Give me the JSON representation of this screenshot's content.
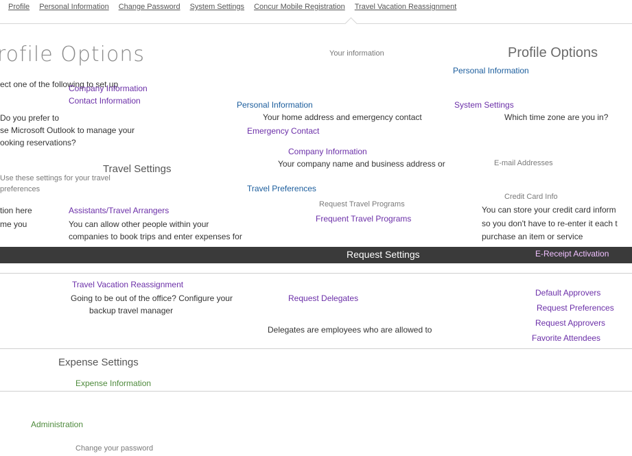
{
  "nav": {
    "tabs": [
      "Profile",
      "Personal Information",
      "Change Password",
      "System Settings",
      "Concur Mobile Registration",
      "Travel Vacation Reassignment"
    ]
  },
  "header": {
    "page_title": "rofile Options",
    "intro": "Your information",
    "profile_title": "Profile Options"
  },
  "left_col": {
    "select_prompt": "ect one of the following to set up",
    "items": [
      "Company Information",
      "Contact Information"
    ],
    "prefs_question": "Do you prefer to",
    "prefs_text": "se Microsoft Outlook to manage your",
    "meetings_text": "ooking reservations?",
    "travel_settings_heading": "Travel Settings",
    "travel_note": "Use these settings for your travel",
    "travel_note2": "preferences",
    "tion_here": "tion here",
    "me_you": "me you"
  },
  "center_col": {
    "personal_information_link": "Personal Information",
    "personal_information_desc": "Your home address and emergency contact",
    "emergency_contact": "Emergency Contact",
    "company_information": "Company Information",
    "company_desc": "Your company name and business address or",
    "travel_preferences": "Travel Preferences",
    "assistants": "Assistants/Travel Arrangers",
    "assistants_desc": "You can allow other people within your",
    "assistants_desc2": "companies to book trips and enter expenses for",
    "request_travel": "Request Travel Programs",
    "frequent_travel": "Frequent Travel Programs"
  },
  "right_col": {
    "personal_information_header": "Personal Information",
    "system_settings": "System Settings",
    "time_zone_question": "Which time zone are you in?",
    "email_addresses": "E-mail Addresses",
    "credit_card": "Credit Card Info",
    "credit_card_desc": "You can store your credit card inform",
    "credit_card_desc2": "so you don't have to re-enter it each t",
    "credit_card_desc3": "purchase an item or service"
  },
  "band": {
    "label": "Request Settings",
    "right": "E-Receipt Activation"
  },
  "mid": {
    "travel_vacation": "Travel Vacation Reassignment",
    "travel_vacation_desc": "Going to be out of the office? Configure your",
    "travel_vacation_desc2": "backup travel manager",
    "delegates": "Request Delegates",
    "delegates_desc": "Delegates are employees who are allowed to",
    "approvers": "Request Approvers",
    "right_links": [
      "Default Approvers",
      "Request Preferences",
      "Request Approvers",
      "Favorite Attendees"
    ],
    "expense_settings_heading": "Expense Settings",
    "expense_information": "Expense Information",
    "administration": "Administration",
    "change_password": "Change your password"
  }
}
